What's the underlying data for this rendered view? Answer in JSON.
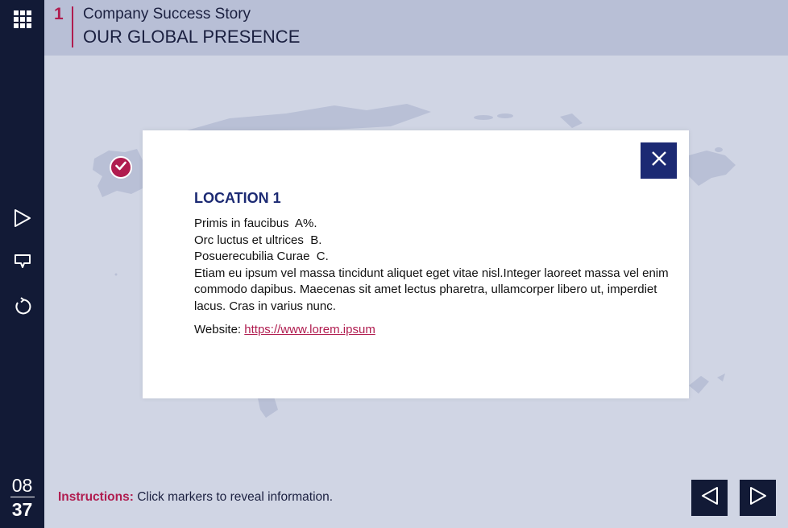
{
  "header": {
    "chapter_number": "1",
    "subtitle": "Company Success Story",
    "title": "OUR GLOBAL PRESENCE"
  },
  "sidebar": {
    "items": [
      {
        "icon": "grid-menu-icon"
      },
      {
        "icon": "play-icon"
      },
      {
        "icon": "comment-icon"
      },
      {
        "icon": "replay-icon"
      }
    ],
    "page_current": "08",
    "page_total": "37"
  },
  "modal": {
    "title": "LOCATION 1",
    "lines": [
      "Primis in faucibus  A%.",
      "Orc luctus et ultrices  B.",
      "Posuerecubilia Curae  C."
    ],
    "paragraph": "Etiam eu ipsum vel massa tincidunt aliquet eget vitae nisl.Integer laoreet massa vel enim commodo dapibus. Maecenas sit amet lectus pharetra, ullamcorper libero ut, imperdiet lacus. Cras in varius nunc.",
    "website_label": "Website:",
    "website_link": "https://www.lorem.ipsum"
  },
  "footer": {
    "instructions_label": "Instructions:",
    "instructions_text": "Click markers to reveal information."
  },
  "colors": {
    "accent": "#b01c4f",
    "navy": "#1c2a73",
    "sidebar": "#121a36",
    "header": "#b8bfd6",
    "background": "#d0d5e4"
  }
}
